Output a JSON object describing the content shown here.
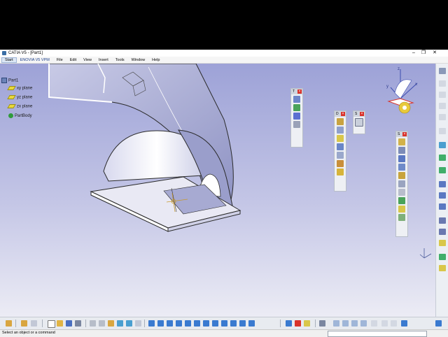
{
  "window": {
    "title": "CATIA V5 - [Part1]",
    "controls": {
      "minimize": "–",
      "restore": "❐",
      "close": "✕"
    }
  },
  "menu": {
    "items": [
      "Start",
      "ENOVIA V5 VPM",
      "File",
      "Edit",
      "View",
      "Insert",
      "Tools",
      "Window",
      "Help"
    ]
  },
  "tree": {
    "root": "Part1",
    "children": [
      "xy plane",
      "yz plane",
      "zx plane",
      "PartBody"
    ]
  },
  "toolbars": {
    "tag_a": "T",
    "tag_b": "D",
    "tag_c": "S",
    "tag_d": "S"
  },
  "compass": {
    "x": "x",
    "y": "y",
    "z": "z"
  },
  "status": {
    "message": "Select an object or a command",
    "command_input": ""
  },
  "colors": {
    "bg_top": "#9ea3d8",
    "bg_bottom": "#e7e7f3",
    "model_face": "#ffffff",
    "model_shade": "#b9bcdf",
    "model_edge": "#2a2a2a",
    "selection_red": "#d9322a",
    "compass_yellow": "#e8c93a"
  }
}
